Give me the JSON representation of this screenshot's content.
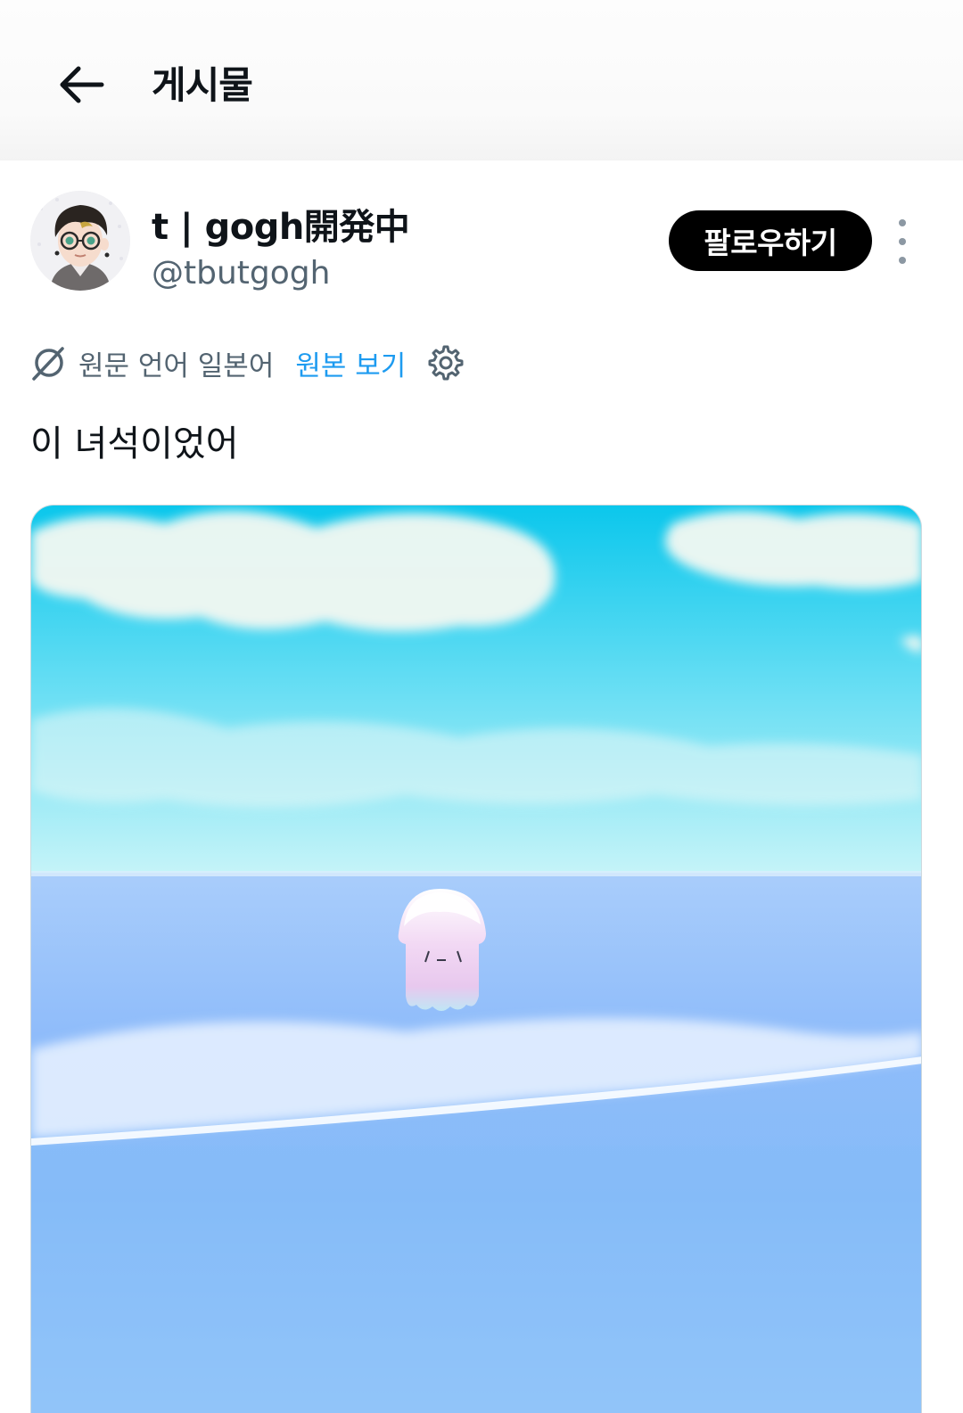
{
  "header": {
    "back_icon": "arrow-left-icon",
    "title": "게시물"
  },
  "author": {
    "display_name": "t | gogh開発中",
    "handle": "@tbutgogh",
    "follow_label": "팔로우하기",
    "more_icon": "more-vertical-icon"
  },
  "translation": {
    "icon": "translate-globe-icon",
    "notice": "원문 언어 일본어",
    "view_original_label": "원본 보기",
    "settings_icon": "gear-icon"
  },
  "post": {
    "text": "이 녀석이었어",
    "media_description_icon": "image-jellyfish-ocean"
  },
  "colors": {
    "accent": "#1d9bf0",
    "follow_bg": "#000000",
    "muted": "#536471"
  }
}
